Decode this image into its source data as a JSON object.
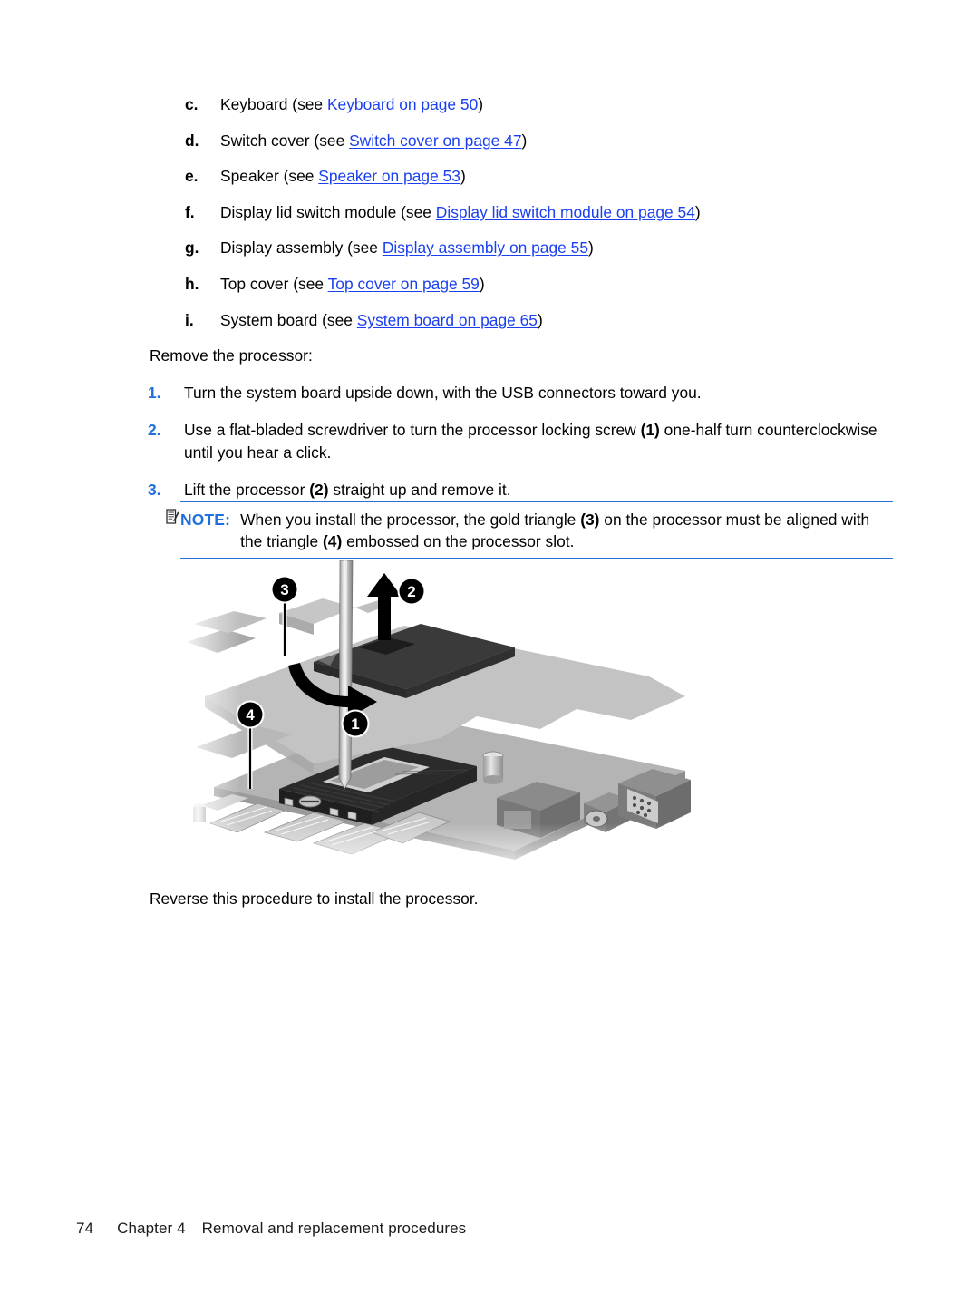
{
  "document": {
    "alpha_list": [
      {
        "marker": "c.",
        "pre": "Keyboard (see ",
        "link": "Keyboard on page 50",
        "post": ")"
      },
      {
        "marker": "d.",
        "pre": "Switch cover (see ",
        "link": "Switch cover on page 47",
        "post": ")"
      },
      {
        "marker": "e.",
        "pre": "Speaker (see ",
        "link": "Speaker on page 53",
        "post": ")"
      },
      {
        "marker": "f.",
        "pre": "Display lid switch module (see ",
        "link": "Display lid switch module on page 54",
        "post": ")"
      },
      {
        "marker": "g.",
        "pre": "Display assembly (see ",
        "link": "Display assembly on page 55",
        "post": ")"
      },
      {
        "marker": "h.",
        "pre": "Top cover (see ",
        "link": "Top cover on page 59",
        "post": ")"
      },
      {
        "marker": "i.",
        "pre": "System board (see ",
        "link": "System board on page 65",
        "post": ")"
      }
    ],
    "lead_in": "Remove the processor:",
    "num_list": [
      {
        "marker": "1.",
        "segments": [
          {
            "text": "Turn the system board upside down, with the USB connectors toward you.",
            "bold": false
          }
        ]
      },
      {
        "marker": "2.",
        "segments": [
          {
            "text": "Use a flat-bladed screwdriver to turn the processor locking screw ",
            "bold": false
          },
          {
            "text": "(1)",
            "bold": true
          },
          {
            "text": " one-half turn counterclockwise until you hear a click.",
            "bold": false
          }
        ]
      },
      {
        "marker": "3.",
        "segments": [
          {
            "text": "Lift the processor ",
            "bold": false
          },
          {
            "text": "(2)",
            "bold": true
          },
          {
            "text": " straight up and remove it.",
            "bold": false
          }
        ]
      }
    ],
    "note": {
      "label": "NOTE:",
      "icon": "note-pencil-icon",
      "segments": [
        {
          "text": "When you install the processor, the gold triangle ",
          "bold": false
        },
        {
          "text": "(3)",
          "bold": true
        },
        {
          "text": " on the processor must be aligned with the triangle ",
          "bold": false
        },
        {
          "text": "(4)",
          "bold": true
        },
        {
          "text": " embossed on the processor slot.",
          "bold": false
        }
      ]
    },
    "figure": {
      "alt": "Exploded view of a laptop system board showing the processor being lifted out of its socket with a flat-bladed screwdriver turning the locking screw",
      "callouts": [
        {
          "id": "3",
          "label": "3",
          "meaning": "gold triangle on processor"
        },
        {
          "id": "2",
          "label": "2",
          "meaning": "lift processor straight up"
        },
        {
          "id": "4",
          "label": "4",
          "meaning": "triangle embossed on processor slot"
        },
        {
          "id": "1",
          "label": "1",
          "meaning": "processor locking screw"
        }
      ]
    },
    "trailer": "Reverse this procedure to install the processor.",
    "footer": {
      "page_number": "74",
      "chapter": "Chapter 4",
      "title": "Removal and replacement procedures"
    }
  },
  "colors": {
    "link": "#1a3ff0",
    "accent_blue": "#1f6fdd",
    "rule_blue": "#2a6fe0",
    "text": "#000000",
    "page_bg": "#ffffff"
  }
}
